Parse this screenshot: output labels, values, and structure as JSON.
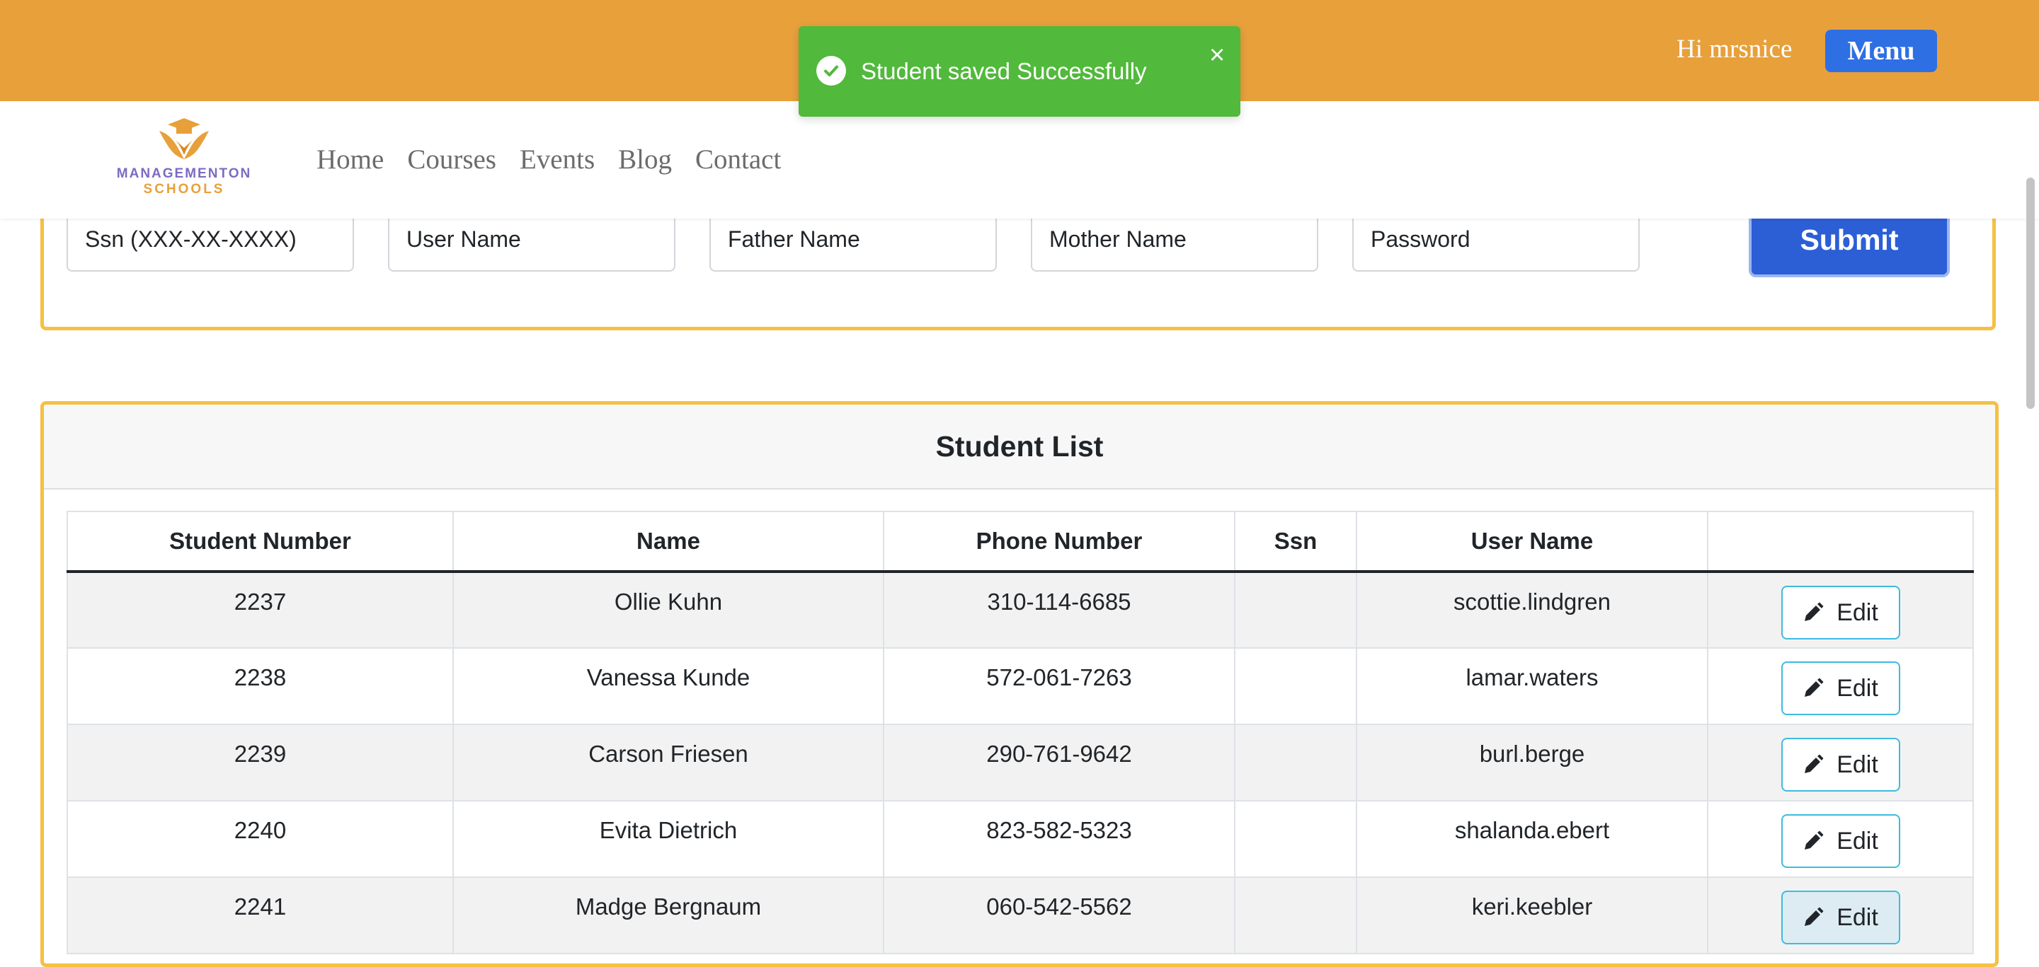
{
  "header": {
    "greeting": "Hi mrsnice",
    "menu_label": "Menu"
  },
  "toast": {
    "message": "Student saved Successfully",
    "close_glyph": "×"
  },
  "logo": {
    "line1": "MANAGEMENTON",
    "line2": "SCHOOLS"
  },
  "nav": {
    "items": [
      "Home",
      "Courses",
      "Events",
      "Blog",
      "Contact"
    ]
  },
  "form": {
    "placeholders": [
      "Ssn (XXX-XX-XXXX)",
      "User Name",
      "Father Name",
      "Mother Name",
      "Password"
    ],
    "submit_label": "Submit"
  },
  "student_list": {
    "title": "Student List",
    "columns": [
      "Student Number",
      "Name",
      "Phone Number",
      "Ssn",
      "User Name",
      ""
    ],
    "rows": [
      {
        "number": "2237",
        "name": "Ollie Kuhn",
        "phone": "310-114-6685",
        "ssn": "",
        "username": "scottie.lindgren",
        "action": "Edit"
      },
      {
        "number": "2238",
        "name": "Vanessa Kunde",
        "phone": "572-061-7263",
        "ssn": "",
        "username": "lamar.waters",
        "action": "Edit"
      },
      {
        "number": "2239",
        "name": "Carson Friesen",
        "phone": "290-761-9642",
        "ssn": "",
        "username": "burl.berge",
        "action": "Edit"
      },
      {
        "number": "2240",
        "name": "Evita Dietrich",
        "phone": "823-582-5323",
        "ssn": "",
        "username": "shalanda.ebert",
        "action": "Edit"
      },
      {
        "number": "2241",
        "name": "Madge Bergnaum",
        "phone": "060-542-5562",
        "ssn": "",
        "username": "keri.keebler",
        "action": "Edit"
      }
    ]
  },
  "icons": {
    "toast": "check-circle-icon",
    "close": "close-icon",
    "edit": "pencil-icon",
    "logo": "graduation-cap-logo"
  },
  "colors": {
    "topbar": "#e8a03b",
    "toast": "#51b93b",
    "primary": "#2f6fe4",
    "card_border": "#f5c043",
    "edit_border": "#3dbbe0"
  }
}
